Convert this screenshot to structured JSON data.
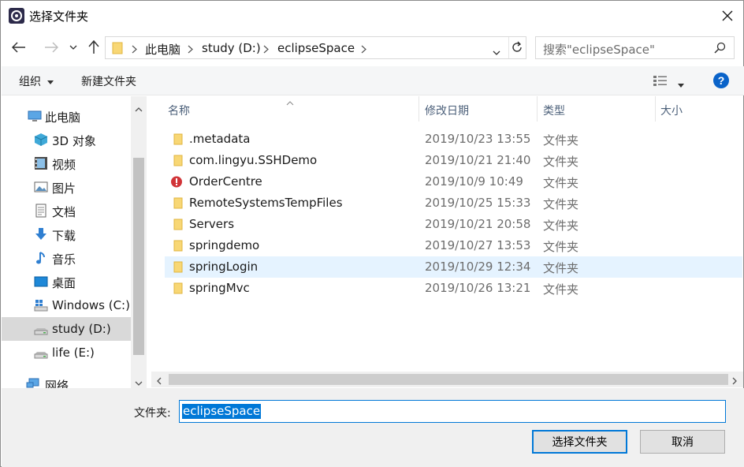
{
  "window": {
    "title": "选择文件夹"
  },
  "address": {
    "crumbs": [
      "此电脑",
      "study (D:)",
      "eclipseSpace"
    ]
  },
  "search": {
    "placeholder": "搜索\"eclipseSpace\""
  },
  "toolbar": {
    "organize": "组织",
    "new_folder": "新建文件夹"
  },
  "sidebar": {
    "items": [
      {
        "label": "此电脑",
        "icon": "computer-icon"
      },
      {
        "label": "3D 对象",
        "icon": "cube-icon"
      },
      {
        "label": "视频",
        "icon": "video-icon"
      },
      {
        "label": "图片",
        "icon": "picture-icon"
      },
      {
        "label": "文档",
        "icon": "document-icon"
      },
      {
        "label": "下载",
        "icon": "download-icon"
      },
      {
        "label": "音乐",
        "icon": "music-icon"
      },
      {
        "label": "桌面",
        "icon": "desktop-icon"
      },
      {
        "label": "Windows (C:)",
        "icon": "windows-drive-icon"
      },
      {
        "label": "study (D:)",
        "icon": "drive-icon",
        "selected": true
      },
      {
        "label": "life (E:)",
        "icon": "drive-icon"
      },
      {
        "label": "网络",
        "icon": "network-icon"
      }
    ]
  },
  "columns": {
    "name": "名称",
    "date": "修改日期",
    "type": "类型",
    "size": "大小"
  },
  "files": [
    {
      "name": ".metadata",
      "date": "2019/10/23 13:55",
      "type": "文件夹",
      "icon": "folder-icon"
    },
    {
      "name": "com.lingyu.SSHDemo",
      "date": "2019/10/21 21:40",
      "type": "文件夹",
      "icon": "folder-icon"
    },
    {
      "name": "OrderCentre",
      "date": "2019/10/9 10:49",
      "type": "文件夹",
      "icon": "conflict-icon"
    },
    {
      "name": "RemoteSystemsTempFiles",
      "date": "2019/10/25 15:33",
      "type": "文件夹",
      "icon": "folder-icon"
    },
    {
      "name": "Servers",
      "date": "2019/10/21 20:58",
      "type": "文件夹",
      "icon": "folder-icon"
    },
    {
      "name": "springdemo",
      "date": "2019/10/27 13:53",
      "type": "文件夹",
      "icon": "folder-icon"
    },
    {
      "name": "springLogin",
      "date": "2019/10/29 12:34",
      "type": "文件夹",
      "icon": "folder-icon",
      "selected": true
    },
    {
      "name": "springMvc",
      "date": "2019/10/26 13:21",
      "type": "文件夹",
      "icon": "folder-icon"
    }
  ],
  "bottom": {
    "folder_label": "文件夹:",
    "folder_value": "eclipseSpace",
    "select_button": "选择文件夹",
    "cancel_button": "取消"
  },
  "colors": {
    "accent": "#0078d7",
    "selected_row": "#e5f3ff",
    "folder": "#f8d775",
    "error": "#d13438"
  }
}
